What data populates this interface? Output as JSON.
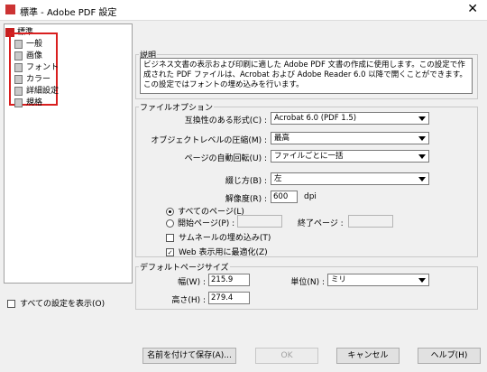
{
  "window": {
    "title": "標準 - Adobe PDF 設定",
    "close_glyph": "✕"
  },
  "tree": {
    "root": "標準",
    "items": [
      "一般",
      "画像",
      "フォント",
      "カラー",
      "詳細設定",
      "規格"
    ]
  },
  "show_all": {
    "label": "すべての設定を表示(O)",
    "checked": false
  },
  "description": {
    "group_label": "説明",
    "text": "ビジネス文書の表示および印刷に適した Adobe PDF 文書の作成に使用します。この設定で作成された PDF ファイルは、Acrobat および Adobe Reader 6.0 以降で開くことができます。この設定ではフォントの埋め込みを行います。"
  },
  "file_options": {
    "group_label": "ファイルオプション",
    "compat_label": "互換性のある形式(C) :",
    "compat_value": "Acrobat 6.0 (PDF 1.5)",
    "objlevel_label": "オブジェクトレベルの圧縮(M) :",
    "objlevel_value": "最高",
    "autorotate_label": "ページの自動回転(U) :",
    "autorotate_value": "ファイルごとに一括",
    "binding_label": "綴じ方(B) :",
    "binding_value": "左",
    "resolution_label": "解像度(R) :",
    "resolution_value": "600",
    "resolution_unit": "dpi",
    "all_pages_label": "すべてのページ(L)",
    "start_page_label": "開始ページ(P) :",
    "end_page_label": "終了ページ :",
    "embed_thumbs_label": "サムネールの埋め込み(T)",
    "web_opt_label": "Web 表示用に最適化(Z)",
    "check_glyph": "✓"
  },
  "page_size": {
    "group_label": "デフォルトページサイズ",
    "width_label": "幅(W) :",
    "width_value": "215.9",
    "unit_label": "単位(N) :",
    "unit_value": "ミリ",
    "height_label": "高さ(H) :",
    "height_value": "279.4"
  },
  "buttons": {
    "save_as": "名前を付けて保存(A)...",
    "ok": "OK",
    "cancel": "キャンセル",
    "help": "ヘルプ(H)"
  }
}
